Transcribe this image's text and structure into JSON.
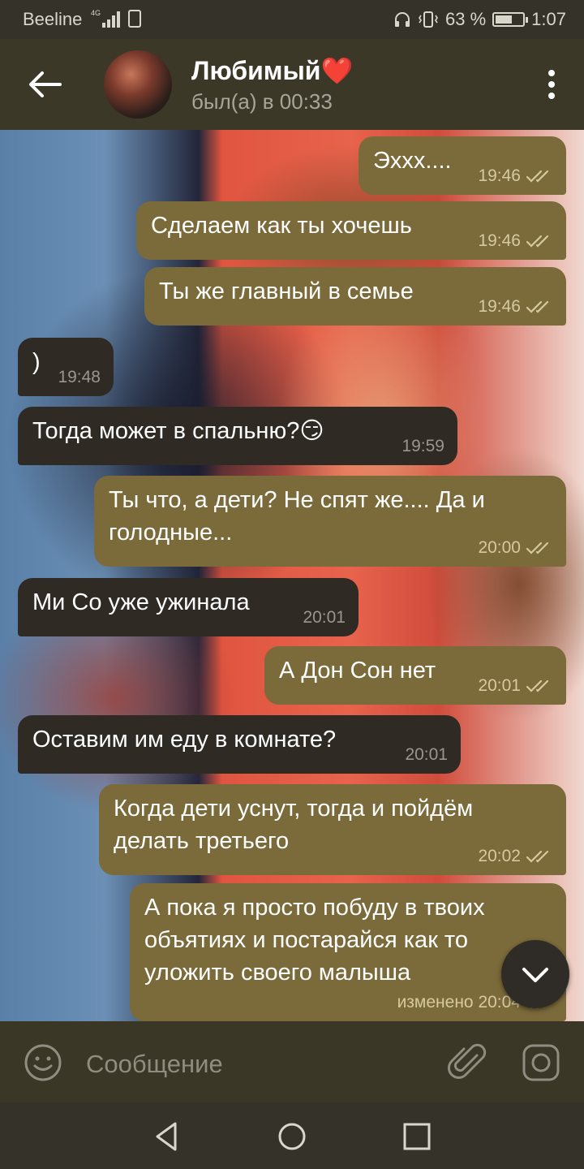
{
  "status_bar": {
    "carrier": "Beeline",
    "network": "4G",
    "battery_percent": "63 %",
    "battery_level": 0.63,
    "time": "1:07"
  },
  "header": {
    "contact_name": "Любимый❤️",
    "last_seen": "был(а) в 00:33"
  },
  "messages": [
    {
      "dir": "out",
      "text": "Эххх....",
      "time": "19:46",
      "read": true
    },
    {
      "dir": "out",
      "text": "Сделаем как ты хочешь",
      "time": "19:46",
      "read": true
    },
    {
      "dir": "out",
      "text": "Ты же главный в семье",
      "time": "19:46",
      "read": true
    },
    {
      "dir": "in",
      "text": ")",
      "time": "19:48"
    },
    {
      "dir": "in",
      "text": "Тогда может в спальню?😏",
      "time": "19:59"
    },
    {
      "dir": "out",
      "text": "Ты что, а дети? Не спят же.... Да и\nголодные...",
      "time": "20:00",
      "read": true
    },
    {
      "dir": "in",
      "text": "Ми Со уже ужинала",
      "time": "20:01"
    },
    {
      "dir": "out",
      "text": "А Дон Сон нет",
      "time": "20:01",
      "read": true
    },
    {
      "dir": "in",
      "text": "Оставим им еду в комнате?",
      "time": "20:01"
    },
    {
      "dir": "out",
      "text": "Когда дети уснут, тогда и пойдём\nделать третьего",
      "time": "20:02",
      "read": true
    },
    {
      "dir": "out",
      "text": "А пока я просто побуду в твоих\nобъятиях и постарайся как то\nуложить своего малыша",
      "time": "изменено 20:04",
      "read": true
    }
  ],
  "input": {
    "placeholder": "Сообщение"
  },
  "icons": {
    "back": "arrow-left-icon",
    "menu": "more-vertical-icon",
    "emoji": "smiley-icon",
    "attach": "paperclip-icon",
    "camera": "camera-icon",
    "scroll_down": "chevron-down-icon"
  },
  "colors": {
    "outgoing_bubble": "#7b6a3a",
    "incoming_bubble": "#2f2b24",
    "header": "#3b3828"
  }
}
